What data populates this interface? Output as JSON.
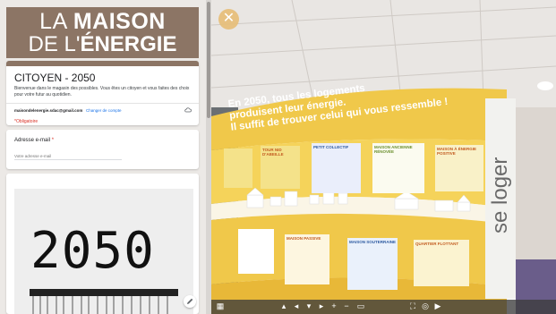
{
  "banner": {
    "line1_thin": "LA ",
    "line1_bold": "MAISON",
    "line2_thin": "DE L'",
    "line2_bold": "ÉNERGIE",
    "bg_color": "#8c7565"
  },
  "form": {
    "title": "CITOYEN - 2050",
    "description": "Bienvenue dans le magasin des possibles. Vous êtes un citoyen et vous faites des choix pour votre futur au quotidien.",
    "account_email": "maisondelenergie.sdac@gmail.com",
    "switch_account": "Changer de compte",
    "required_note": "*Obligatoire",
    "email_label": "Adresse e-mail",
    "email_required_mark": "*",
    "email_placeholder": "Votre adresse e-mail",
    "image_text": "2050"
  },
  "viewer": {
    "close_glyph": "✕",
    "headline": [
      "En 2050, tous les logements",
      "produisent leur énergie.",
      "Il suffit de trouver celui qui vous ressemble !"
    ],
    "side_banner": "se loger",
    "signs_top": [
      "TOUR NID D'ABEILLE",
      "PETIT COLLECTIF",
      "MAISON ANCIENNE RÉNOVÉE",
      "MAISON À ÉNERGIE POSITIVE"
    ],
    "signs_bottom": [
      "MAISON PASSIVE",
      "MAISON SOUTERRAINE",
      "QUARTIER FLOTTANT"
    ],
    "accent_color": "#f0c84a"
  },
  "toolbar": {
    "icons": [
      "grid-icon",
      "chevron-up-icon",
      "chevron-left-icon",
      "chevron-down-icon",
      "chevron-right-icon",
      "zoom-in-icon",
      "zoom-out-icon",
      "vr-icon",
      "fullscreen-icon",
      "gyro-icon"
    ]
  }
}
